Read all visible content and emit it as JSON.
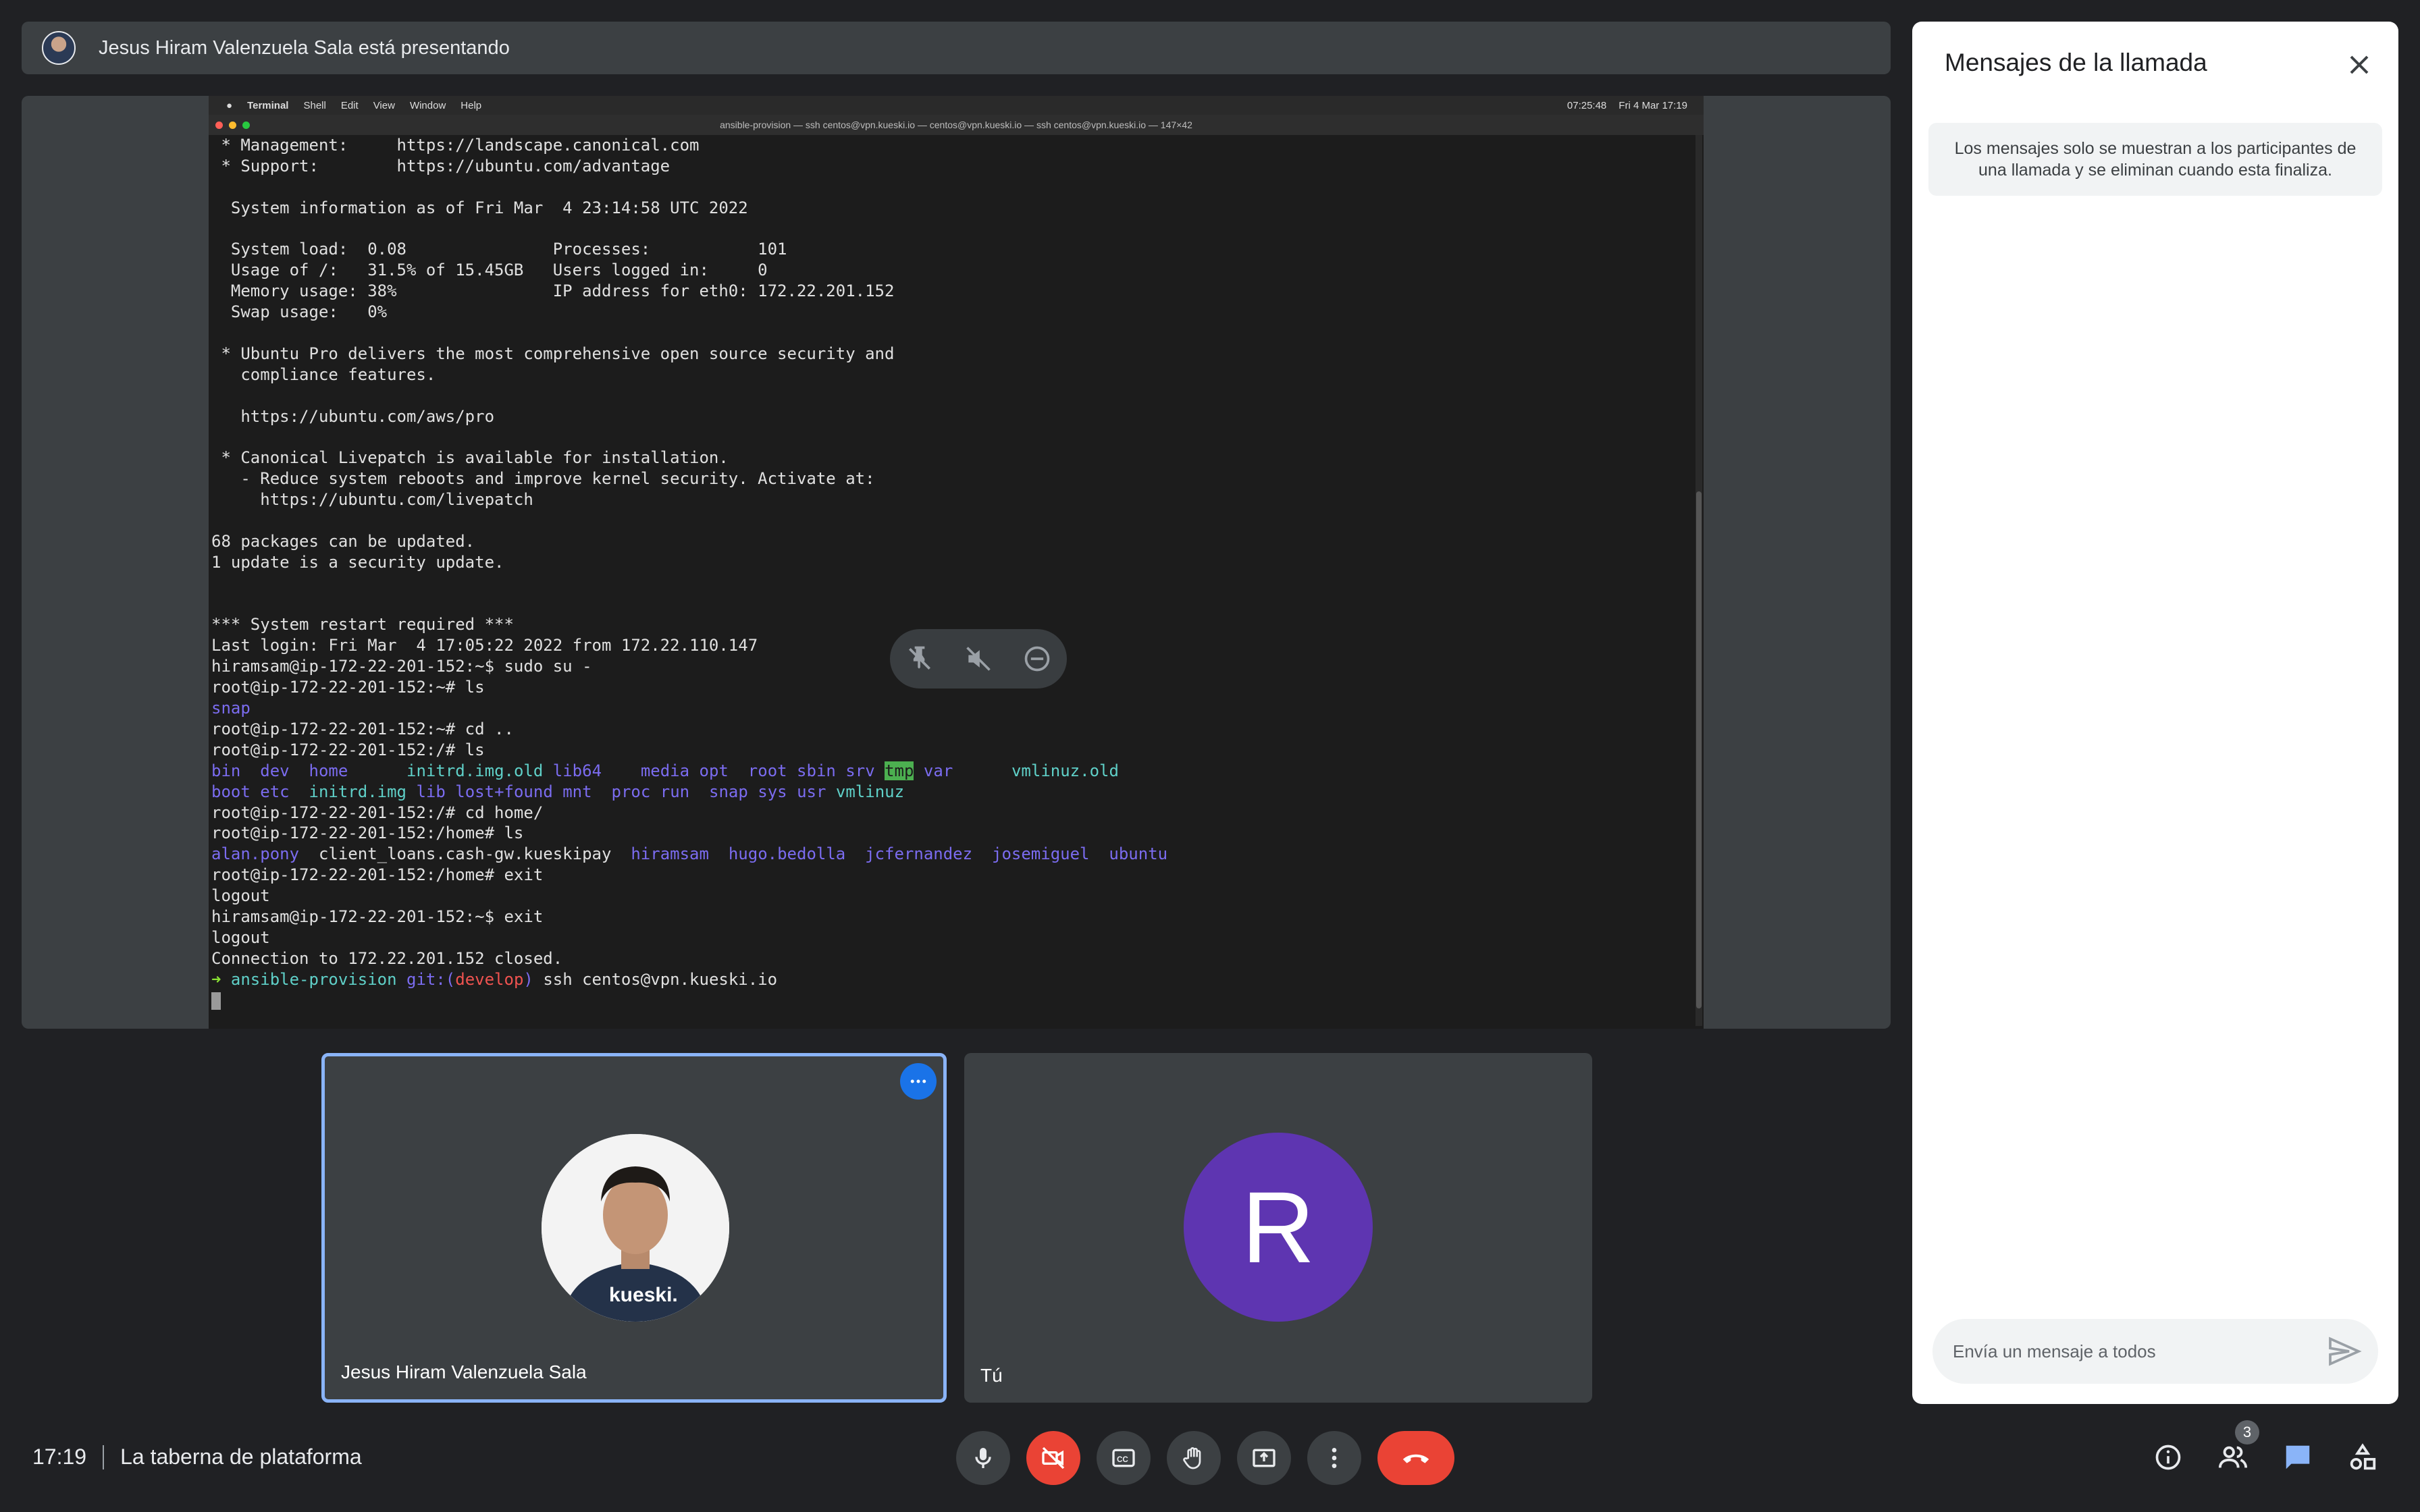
{
  "presenting_bar": {
    "text": "Jesus Hiram Valenzuela Sala está presentando"
  },
  "mac_menu": {
    "app": "Terminal",
    "items": [
      "Shell",
      "Edit",
      "View",
      "Window",
      "Help"
    ],
    "clock": "07:25:48",
    "date": "Fri 4 Mar  17:19"
  },
  "terminal": {
    "title": "ansible-provision — ssh centos@vpn.kueski.io — centos@vpn.kueski.io — ssh centos@vpn.kueski.io — 147×42",
    "lines": [
      " * Management:     https://landscape.canonical.com",
      " * Support:        https://ubuntu.com/advantage",
      "",
      "  System information as of Fri Mar  4 23:14:58 UTC 2022",
      "",
      "  System load:  0.08               Processes:           101",
      "  Usage of /:   31.5% of 15.45GB   Users logged in:     0",
      "  Memory usage: 38%                IP address for eth0: 172.22.201.152",
      "  Swap usage:   0%",
      "",
      " * Ubuntu Pro delivers the most comprehensive open source security and",
      "   compliance features.",
      "",
      "   https://ubuntu.com/aws/pro",
      "",
      " * Canonical Livepatch is available for installation.",
      "   - Reduce system reboots and improve kernel security. Activate at:",
      "     https://ubuntu.com/livepatch",
      "",
      "68 packages can be updated.",
      "1 update is a security update.",
      "",
      "",
      "*** System restart required ***",
      "Last login: Fri Mar  4 17:05:22 2022 from 172.22.110.147",
      "hiramsam@ip-172-22-201-152:~$ sudo su -",
      "root@ip-172-22-201-152:~# ls"
    ],
    "snap_line": "snap",
    "lines2": [
      "root@ip-172-22-201-152:~# cd ..",
      "root@ip-172-22-201-152:/# ls"
    ],
    "ls_row1": [
      "bin",
      "dev",
      "home",
      "initrd.img.old",
      "lib64",
      "media",
      "opt",
      "root",
      "sbin",
      "srv",
      "tmp",
      "var",
      "vmlinuz.old"
    ],
    "ls_row2": [
      "boot",
      "etc",
      "initrd.img",
      "lib",
      "lost+found",
      "mnt",
      "proc",
      "run",
      "snap",
      "sys",
      "usr",
      "vmlinuz"
    ],
    "lines3": [
      "root@ip-172-22-201-152:/# cd home/",
      "root@ip-172-22-201-152:/home# ls"
    ],
    "home_ls": [
      "alan.pony",
      "client_loans.cash-gw.kueskipay",
      "hiramsam",
      "hugo.bedolla",
      "jcfernandez",
      "josemiguel",
      "ubuntu"
    ],
    "lines4": [
      "root@ip-172-22-201-152:/home# exit",
      "logout",
      "hiramsam@ip-172-22-201-152:~$ exit",
      "logout",
      "Connection to 172.22.201.152 closed."
    ],
    "prompt": {
      "arrow": "➜",
      "dir": "ansible-provision",
      "git": "git:(",
      "branch": "develop",
      "git_close": ")",
      "command": "ssh centos@vpn.kueski.io"
    }
  },
  "tiles": {
    "presenter": {
      "name": "Jesus Hiram Valenzuela Sala"
    },
    "self": {
      "name": "Tú",
      "initial": "R"
    }
  },
  "bottom": {
    "time": "17:19",
    "meeting_name": "La taberna de plataforma",
    "participant_count": "3"
  },
  "chat": {
    "title": "Mensajes de la llamada",
    "notice": "Los mensajes solo se muestran a los participantes de una llamada y se eliminan cuando esta finaliza.",
    "input_placeholder": "Envía un mensaje a todos"
  },
  "colors": {
    "accent": "#8ab4f8",
    "end_call": "#ea4335",
    "avatar_purple": "#5e35b1"
  }
}
